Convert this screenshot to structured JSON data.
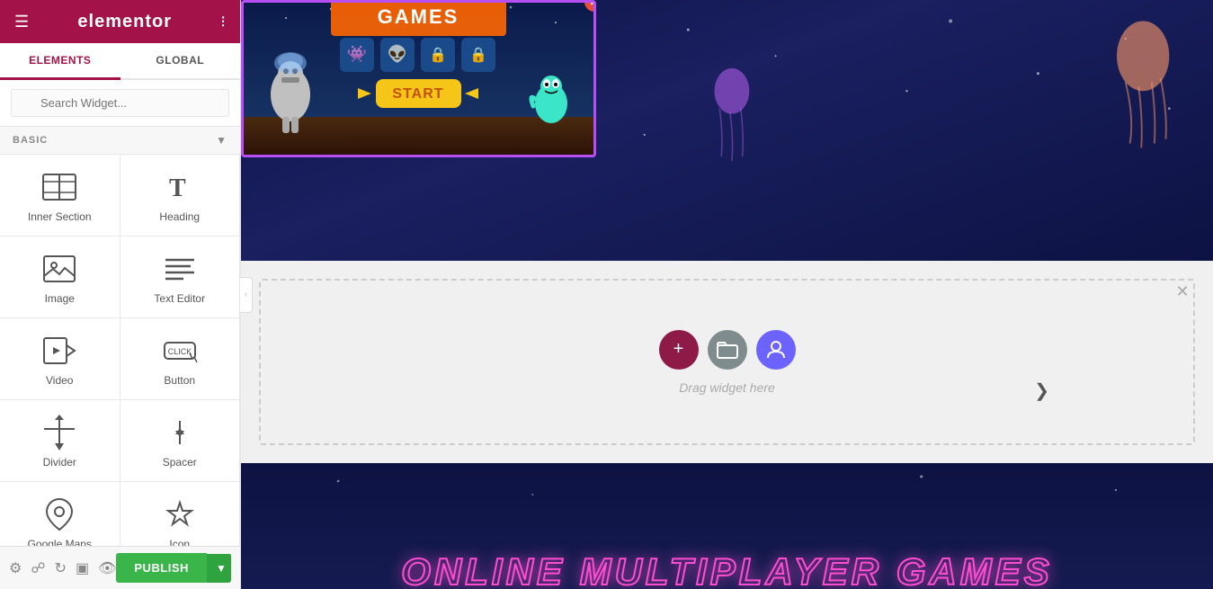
{
  "header": {
    "logo": "elementor",
    "hamburger_icon": "☰",
    "grid_icon": "⊞"
  },
  "tabs": {
    "elements": "ELEMENTS",
    "global": "GLOBAL"
  },
  "search": {
    "placeholder": "Search Widget..."
  },
  "section_label": "BASIC",
  "widgets": [
    {
      "id": "inner-section",
      "label": "Inner Section",
      "icon_type": "inner-section-icon"
    },
    {
      "id": "heading",
      "label": "Heading",
      "icon_type": "heading-icon"
    },
    {
      "id": "image",
      "label": "Image",
      "icon_type": "image-icon"
    },
    {
      "id": "text-editor",
      "label": "Text Editor",
      "icon_type": "text-editor-icon"
    },
    {
      "id": "video",
      "label": "Video",
      "icon_type": "video-icon"
    },
    {
      "id": "button",
      "label": "Button",
      "icon_type": "button-icon"
    },
    {
      "id": "divider",
      "label": "Divider",
      "icon_type": "divider-icon"
    },
    {
      "id": "spacer",
      "label": "Spacer",
      "icon_type": "spacer-icon"
    },
    {
      "id": "google-maps",
      "label": "Google Maps",
      "icon_type": "google-maps-icon"
    },
    {
      "id": "icon",
      "label": "Icon",
      "icon_type": "icon-widget-icon"
    }
  ],
  "bottom_bar": {
    "publish_label": "PUBLISH"
  },
  "canvas": {
    "drag_label": "Drag widget here",
    "online_text": "ONLINE MULTIPLAYER GAMES"
  }
}
